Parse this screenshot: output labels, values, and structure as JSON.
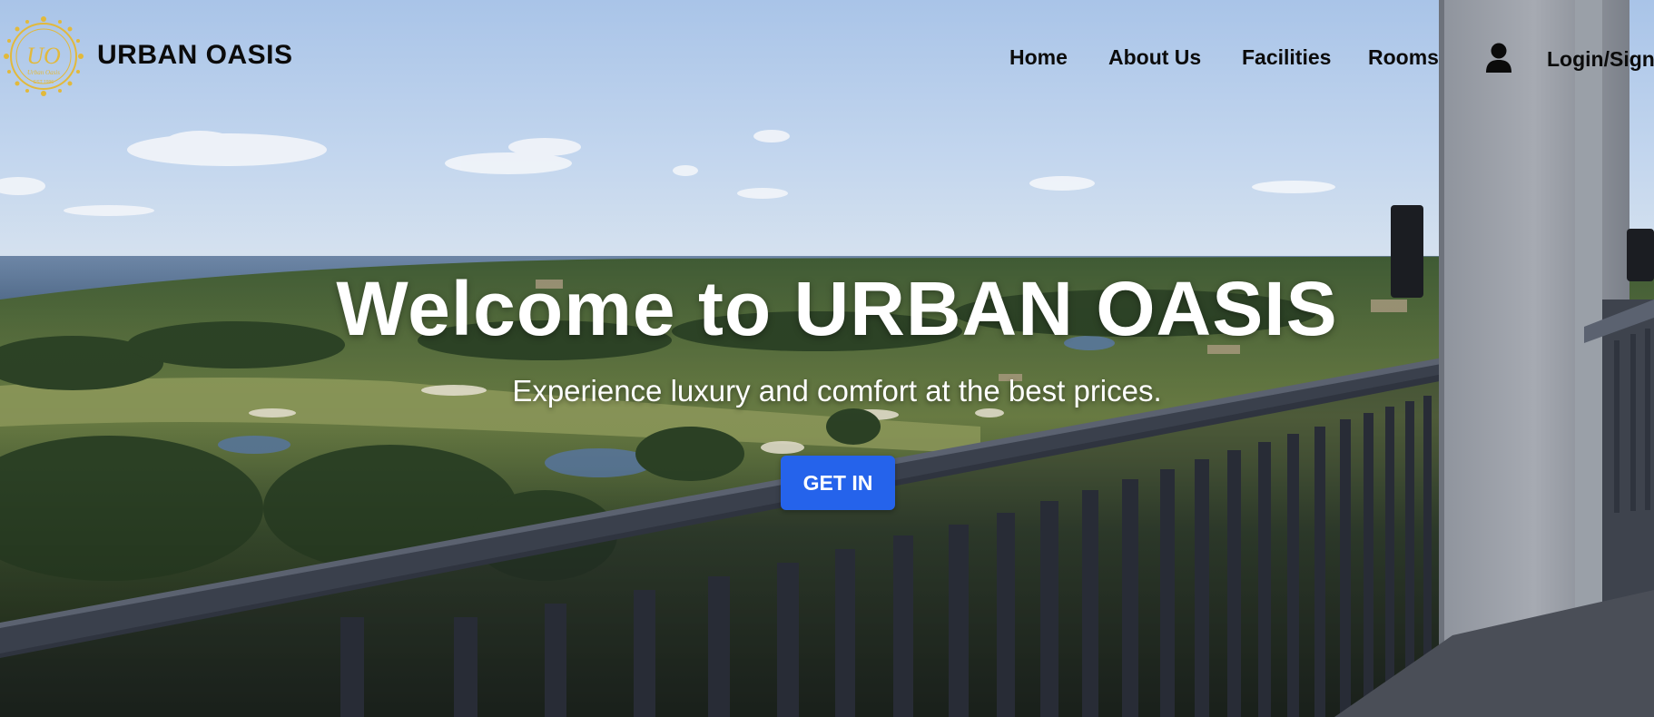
{
  "brand": {
    "name": "URBAN OASIS",
    "logo_monogram": "UO",
    "logo_caption": "Urban Oasis",
    "logo_est": "EST 1996"
  },
  "nav": {
    "items": [
      {
        "label": "Home"
      },
      {
        "label": "About Us"
      },
      {
        "label": "Facilities"
      },
      {
        "label": "Rooms"
      }
    ],
    "user_icon": "user-icon",
    "login_label": "Login/Signup"
  },
  "hero": {
    "title": "Welcome to URBAN OASIS",
    "subtitle": "Experience luxury and comfort at the best prices.",
    "cta_label": "GET IN"
  },
  "colors": {
    "accent": "#2563eb",
    "logo_gold": "#e2b93b",
    "text_dark": "#0b0b0b"
  }
}
